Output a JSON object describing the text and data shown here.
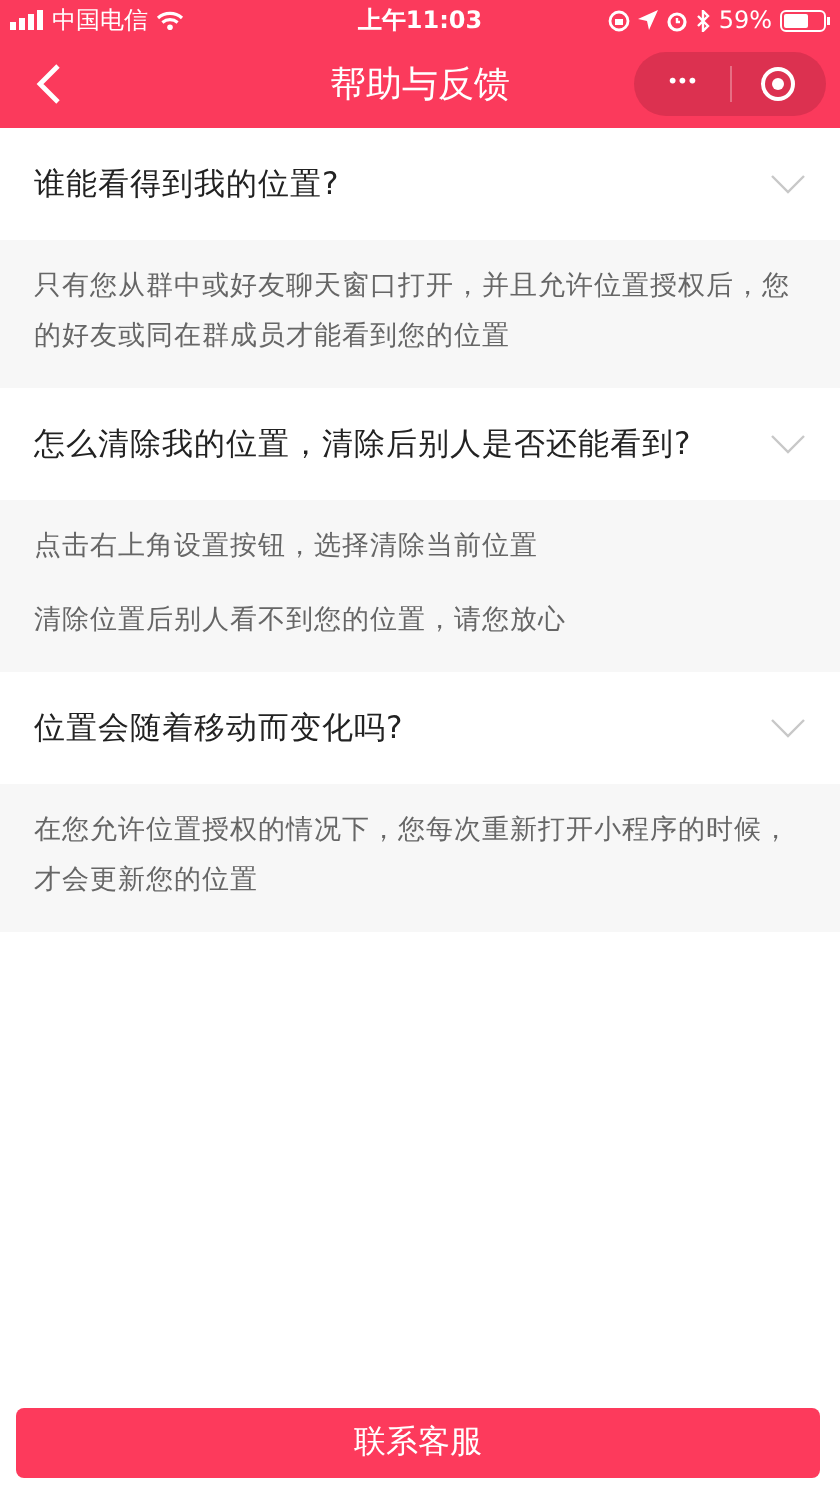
{
  "status_bar": {
    "carrier": "中国电信",
    "time": "上午11:03",
    "battery": "59%"
  },
  "nav": {
    "title": "帮助与反馈",
    "more": "•••"
  },
  "faq": [
    {
      "question": "谁能看得到我的位置?",
      "expanded": true,
      "answer": [
        "只有您从群中或好友聊天窗口打开，并且允许位置授权后，您的好友或同在群成员才能看到您的位置"
      ]
    },
    {
      "question": "怎么清除我的位置，清除后别人是否还能看到?",
      "expanded": true,
      "answer": [
        "点击右上角设置按钮，选择清除当前位置",
        "清除位置后别人看不到您的位置，请您放心"
      ]
    },
    {
      "question": "位置会随着移动而变化吗?",
      "expanded": true,
      "answer": [
        "在您允许位置授权的情况下，您每次重新打开小程序的时候，才会更新您的位置"
      ]
    }
  ],
  "contact_button": "联系客服"
}
